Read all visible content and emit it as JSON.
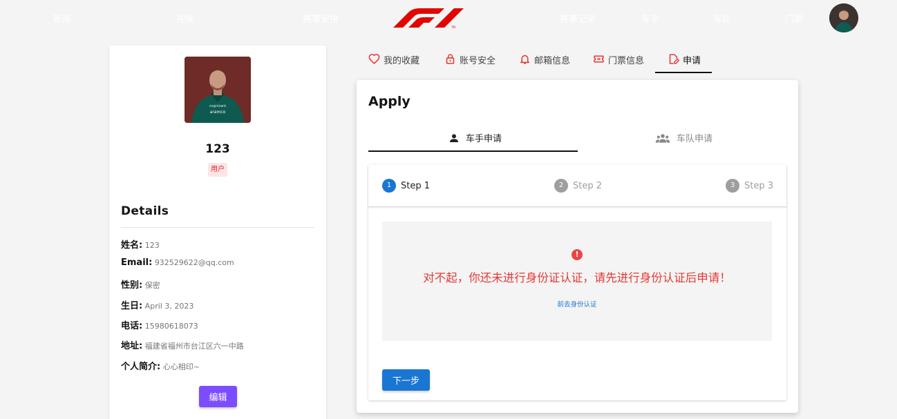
{
  "nav": {
    "items": [
      "新闻",
      "视频",
      "赛事安排",
      "赛事记录",
      "车手",
      "车队",
      "门票"
    ],
    "logo_text": "F1"
  },
  "profile": {
    "name": "123",
    "role_badge": "用户",
    "details_title": "Details",
    "fields": [
      {
        "label": "姓名:",
        "value": "123"
      },
      {
        "label": "Email:",
        "value": "932529622@qq.com"
      },
      {
        "label": "性别:",
        "value": "保密"
      },
      {
        "label": "生日:",
        "value": "April 3, 2023"
      },
      {
        "label": "电话:",
        "value": "15980618073"
      },
      {
        "label": "地址:",
        "value": "福建省福州市台江区六一中路"
      },
      {
        "label": "个人简介:",
        "value": "心心相印~"
      }
    ],
    "edit_label": "编辑"
  },
  "tabs": [
    {
      "label": "我的收藏",
      "icon": "heart-icon"
    },
    {
      "label": "账号安全",
      "icon": "lock-icon"
    },
    {
      "label": "邮箱信息",
      "icon": "bell-icon"
    },
    {
      "label": "门票信息",
      "icon": "ticket-icon"
    },
    {
      "label": "申请",
      "icon": "edit-document-icon",
      "active": true
    }
  ],
  "apply": {
    "title": "Apply",
    "sub_tabs": [
      {
        "label": "车手申请",
        "icon": "person-icon",
        "active": true
      },
      {
        "label": "车队申请",
        "icon": "group-icon"
      }
    ],
    "steps": [
      {
        "num": "1",
        "label": "Step 1",
        "active": true
      },
      {
        "num": "2",
        "label": "Step 2"
      },
      {
        "num": "3",
        "label": "Step 3"
      }
    ],
    "alert_icon": "!",
    "notice": "对不起，你还未进行身份证认证，请先进行身份认证后申请！",
    "verify_link": "前去身份认证",
    "next_label": "下一步"
  },
  "colors": {
    "accent_red": "#e53935",
    "primary_blue": "#1976d2",
    "edit_purple": "#7c4dff",
    "f1_red": "#e10600"
  }
}
